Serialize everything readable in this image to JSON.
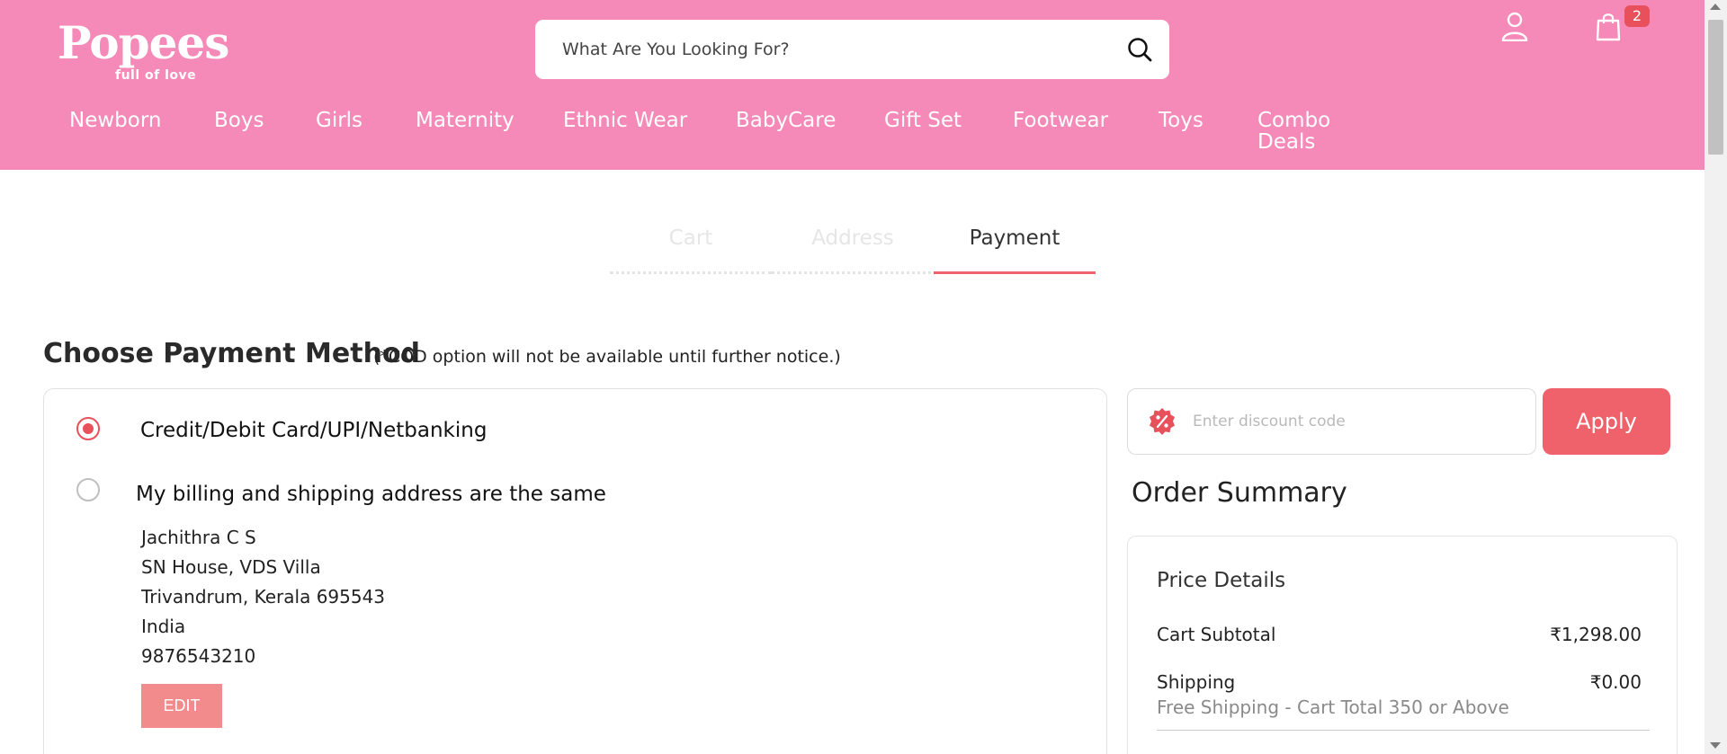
{
  "brand": {
    "logo_text": "Popees",
    "tagline": "full of love",
    "header_color": "#f589b7",
    "accent": "#f0626b"
  },
  "search": {
    "placeholder": "What Are You Looking For?",
    "icon": "search-icon"
  },
  "header_icons": {
    "user_icon": "user-icon",
    "cart_icon": "shopping-bag-icon",
    "cart_count": "2"
  },
  "nav": {
    "items": [
      "Newborn",
      "Boys",
      "Girls",
      "Maternity",
      "Ethnic Wear",
      "BabyCare",
      "Gift Set",
      "Footwear",
      "Toys",
      "Combo Deals"
    ]
  },
  "steps": {
    "items": [
      "Cart",
      "Address",
      "Payment"
    ],
    "active": "Payment"
  },
  "payment": {
    "title": "Choose Payment Method",
    "note": "(*COD option will not be available until further notice.)",
    "option_label": "Credit/Debit Card/UPI/Netbanking",
    "option_selected": true,
    "same_address_label": "My billing and shipping address are the same",
    "same_address_checked": false,
    "address": {
      "name": "Jachithra C S",
      "line1": "SN House, VDS Villa",
      "line2": "Trivandrum, Kerala 695543",
      "country": "India",
      "phone": "9876543210"
    },
    "edit_label": "EDIT"
  },
  "discount": {
    "placeholder": "Enter discount code",
    "icon": "percent-badge-icon",
    "apply_label": "Apply"
  },
  "order_summary": {
    "title": "Order Summary",
    "price_details_title": "Price Details",
    "cart_subtotal_label": "Cart Subtotal",
    "cart_subtotal_value": "₹1,298.00",
    "shipping_label": "Shipping",
    "shipping_value": "₹0.00",
    "shipping_note": "Free Shipping - Cart Total 350 or Above"
  }
}
